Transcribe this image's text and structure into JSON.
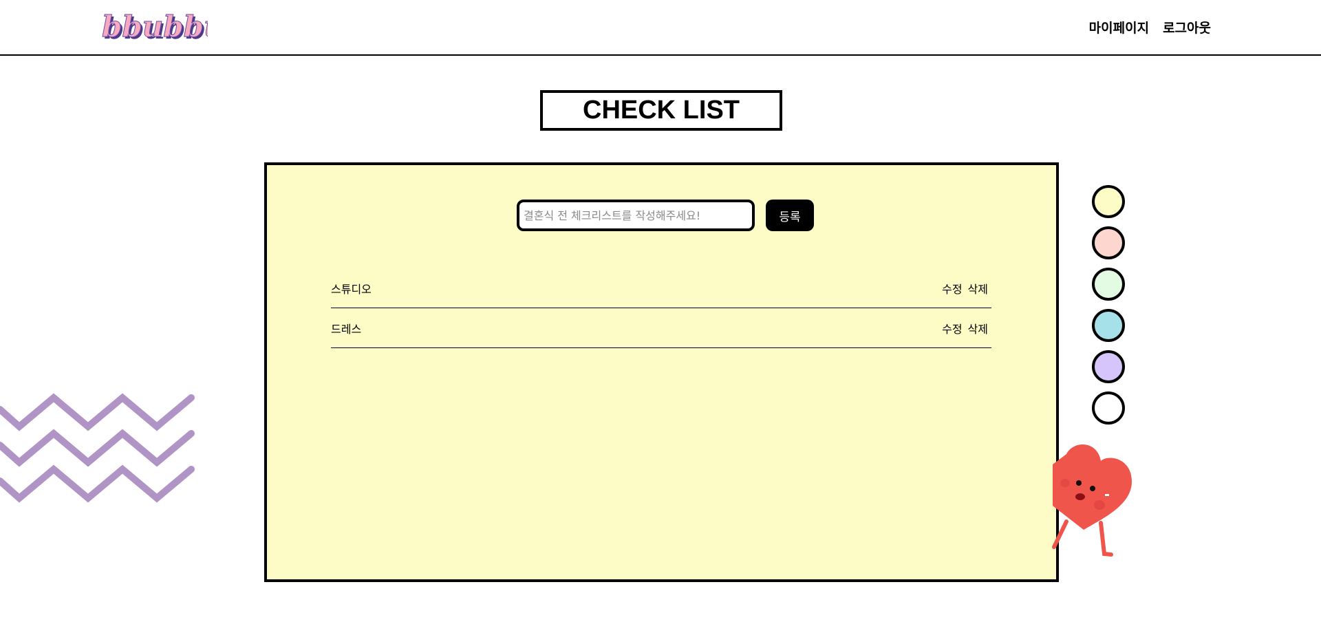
{
  "header": {
    "logo_text": "bbubbu",
    "nav": [
      {
        "label": "마이페이지"
      },
      {
        "label": "로그아웃"
      }
    ]
  },
  "main": {
    "title": "CHECK LIST",
    "form": {
      "input_value": "",
      "placeholder": "결혼식 전 체크리스트를 작성해주세요!",
      "submit_label": "등록"
    },
    "items": [
      {
        "text": "스튜디오",
        "edit_label": "수정",
        "delete_label": "삭제"
      },
      {
        "text": "드레스",
        "edit_label": "수정",
        "delete_label": "삭제"
      }
    ]
  },
  "swatches": [
    {
      "color": "#fefcc6"
    },
    {
      "color": "#fdd6d0"
    },
    {
      "color": "#e3fbe3"
    },
    {
      "color": "#a6e1ea"
    },
    {
      "color": "#d5c5fb"
    },
    {
      "color": "#ffffff"
    }
  ],
  "decor": {
    "zigzag_color": "#b094c6",
    "heart_color": "#f0554c"
  }
}
